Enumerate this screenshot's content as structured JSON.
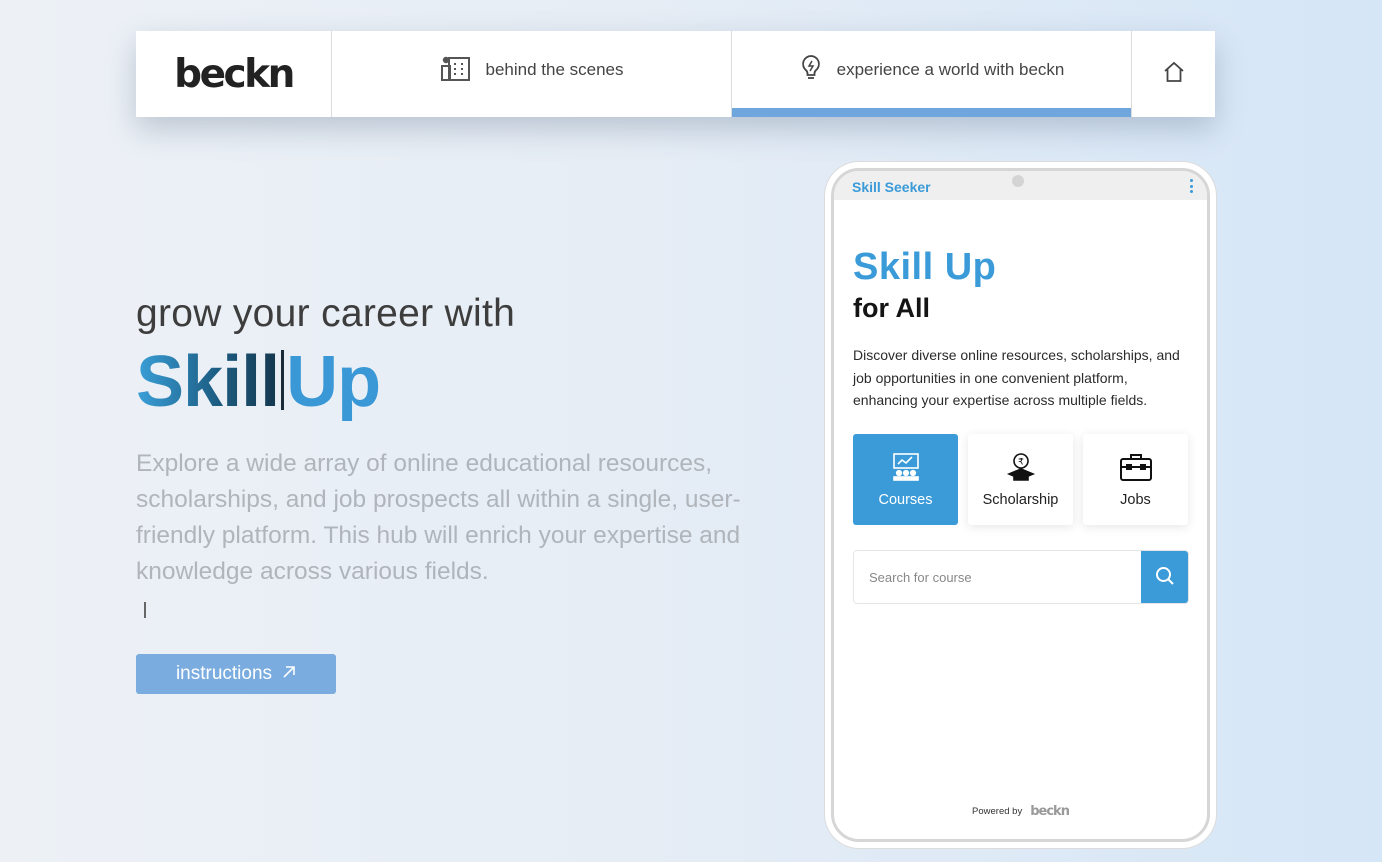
{
  "nav": {
    "logo": "beckn",
    "tabs": [
      {
        "label": "behind the scenes",
        "icon": "building-icon",
        "active": false
      },
      {
        "label": "experience a world with beckn",
        "icon": "lightbulb-icon",
        "active": true
      }
    ],
    "home_icon": "home-icon"
  },
  "hero": {
    "pre_title": "grow your career with",
    "brand_part1": "Skill",
    "brand_part2": "Up",
    "description": "Explore a wide array of online educational resources, scholarships, and job prospects all within a single, user-friendly platform. This hub will enrich your expertise and knowledge across various fields.",
    "button_label": "instructions",
    "button_icon": "arrow-up-right-icon"
  },
  "phone": {
    "app_name": "Skill Seeker",
    "title": "Skill Up",
    "subtitle": "for All",
    "description": "Discover diverse online resources, scholarships, and job opportunities in one convenient platform, enhancing your expertise across multiple fields.",
    "categories": [
      {
        "label": "Courses",
        "icon": "presentation-board-icon",
        "active": true
      },
      {
        "label": "Scholarship",
        "icon": "graduation-coin-icon",
        "active": false
      },
      {
        "label": "Jobs",
        "icon": "briefcase-icon",
        "active": false
      }
    ],
    "search_placeholder": "Search for course",
    "powered_by": "Powered by",
    "powered_logo": "beckn"
  },
  "colors": {
    "accent": "#3a9bd8",
    "nav_active_bar": "#6ea6dd",
    "button": "#7aacdf"
  }
}
